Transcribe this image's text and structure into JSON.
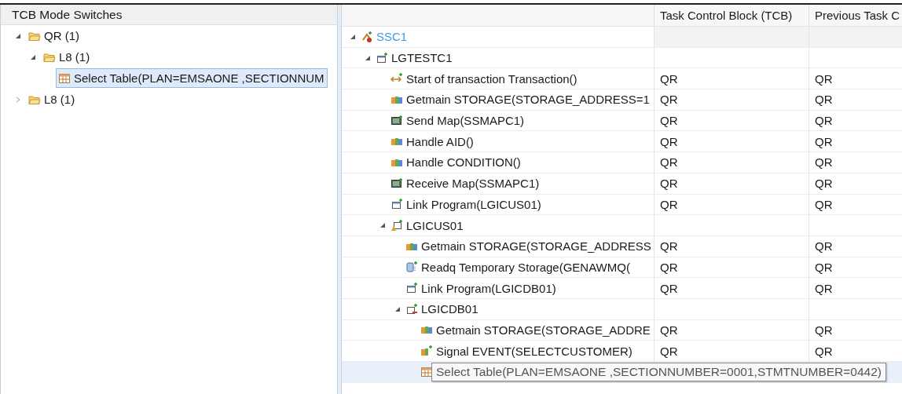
{
  "left_panel": {
    "title": "TCB Mode Switches",
    "tree": [
      {
        "label": "QR (1)",
        "kind": "folder",
        "expanded": true,
        "selected": false,
        "children": [
          {
            "label": "L8 (1)",
            "kind": "folder",
            "expanded": true,
            "selected": false,
            "children": [
              {
                "label": "Select Table(PLAN=EMSAONE ,SECTIONNUM",
                "kind": "table",
                "selected": true
              }
            ]
          }
        ]
      },
      {
        "label": "L8 (1)",
        "kind": "folder",
        "expanded": false,
        "selected": false
      }
    ]
  },
  "right_panel": {
    "columns": [
      "Task Control Block (TCB)",
      "Previous Task C"
    ],
    "tree": [
      {
        "label": "SSC1",
        "kind": "region",
        "expanded": true,
        "selected": false,
        "children": [
          {
            "label": "LGTESTC1",
            "kind": "program",
            "expanded": true,
            "selected": false,
            "children": [
              {
                "label": "Start of transaction Transaction()",
                "kind": "transaction",
                "tcb": "QR",
                "previous_tcb": "QR",
                "selected": false
              },
              {
                "label": "Getmain STORAGE(STORAGE_ADDRESS=1",
                "kind": "storage",
                "tcb": "QR",
                "previous_tcb": "QR",
                "selected": false
              },
              {
                "label": "Send Map(SSMAPC1)",
                "kind": "map",
                "tcb": "QR",
                "previous_tcb": "QR",
                "selected": false
              },
              {
                "label": "Handle AID()",
                "kind": "storage",
                "tcb": "QR",
                "previous_tcb": "QR",
                "selected": false
              },
              {
                "label": "Handle CONDITION()",
                "kind": "storage",
                "tcb": "QR",
                "previous_tcb": "QR",
                "selected": false
              },
              {
                "label": "Receive Map(SSMAPC1)",
                "kind": "map",
                "tcb": "QR",
                "previous_tcb": "QR",
                "selected": false
              },
              {
                "label": "Link Program(LGICUS01)",
                "kind": "link",
                "tcb": "QR",
                "previous_tcb": "QR",
                "selected": false
              },
              {
                "label": "LGICUS01",
                "kind": "program-warning",
                "expanded": true,
                "selected": false,
                "children": [
                  {
                    "label": "Getmain STORAGE(STORAGE_ADDRESS",
                    "kind": "storage",
                    "tcb": "QR",
                    "previous_tcb": "QR",
                    "selected": false
                  },
                  {
                    "label": "Readq Temporary Storage(GENAWMQ(",
                    "kind": "queue",
                    "tcb": "QR",
                    "previous_tcb": "QR",
                    "selected": false
                  },
                  {
                    "label": "Link Program(LGICDB01)",
                    "kind": "link",
                    "tcb": "QR",
                    "previous_tcb": "QR",
                    "selected": false
                  },
                  {
                    "label": "LGICDB01",
                    "kind": "program-db",
                    "expanded": true,
                    "selected": false,
                    "children": [
                      {
                        "label": "Getmain STORAGE(STORAGE_ADDRE",
                        "kind": "storage",
                        "tcb": "QR",
                        "previous_tcb": "QR",
                        "selected": false
                      },
                      {
                        "label": "Signal EVENT(SELECTCUSTOMER)",
                        "kind": "signal",
                        "tcb": "QR",
                        "previous_tcb": "QR",
                        "selected": false
                      },
                      {
                        "kind": "table",
                        "selected": true,
                        "tooltip": "Select Table(PLAN=EMSAONE ,SECTIONNUMBER=0001,STMTNUMBER=0442)"
                      }
                    ]
                  }
                ]
              }
            ]
          }
        ]
      }
    ]
  }
}
